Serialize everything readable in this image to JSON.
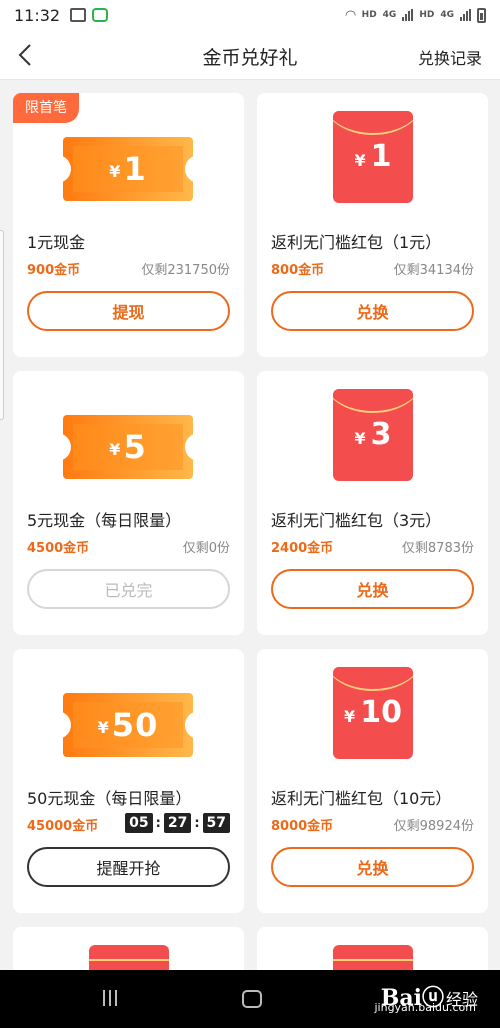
{
  "status_bar": {
    "time": "11:32",
    "net_label_1": "HD",
    "net_label_2": "4G",
    "net_label_3": "HD",
    "net_label_4": "4G"
  },
  "nav": {
    "title": "金币兑好礼",
    "right_link": "兑换记录"
  },
  "cards": [
    {
      "badge": "限首笔",
      "type": "coupon",
      "currency": "¥",
      "amount": "1",
      "title": "1元现金",
      "price": "900金币",
      "stock": "仅剩231750份",
      "button": "提现",
      "button_state": "active"
    },
    {
      "type": "envelope",
      "currency": "¥",
      "amount": "1",
      "title": "返利无门槛红包（1元）",
      "price": "800金币",
      "stock": "仅剩34134份",
      "button": "兑换",
      "button_state": "active"
    },
    {
      "type": "coupon",
      "currency": "¥",
      "amount": "5",
      "title": "5元现金（每日限量）",
      "price": "4500金币",
      "stock": "仅剩0份",
      "button": "已兑完",
      "button_state": "disabled"
    },
    {
      "type": "envelope",
      "currency": "¥",
      "amount": "3",
      "title": "返利无门槛红包（3元）",
      "price": "2400金币",
      "stock": "仅剩8783份",
      "button": "兑换",
      "button_state": "active"
    },
    {
      "type": "coupon",
      "currency": "¥",
      "amount": "50",
      "title": "50元现金（每日限量）",
      "price": "45000金币",
      "countdown": {
        "h": "05",
        "m": "27",
        "s": "57"
      },
      "button": "提醒开抢",
      "button_state": "remind"
    },
    {
      "type": "envelope",
      "currency": "¥",
      "amount": "10",
      "title": "返利无门槛红包（10元）",
      "price": "8000金币",
      "stock": "仅剩98924份",
      "button": "兑换",
      "button_state": "active"
    }
  ],
  "watermark": {
    "logo": "Bai",
    "logo_tail": "经验",
    "url": "jingyan.baidu.com"
  },
  "colors": {
    "accent": "#ec6a19",
    "badge": "#ff6a3d",
    "envelope": "#f44d4d",
    "coupon": "#ff8a1a"
  }
}
